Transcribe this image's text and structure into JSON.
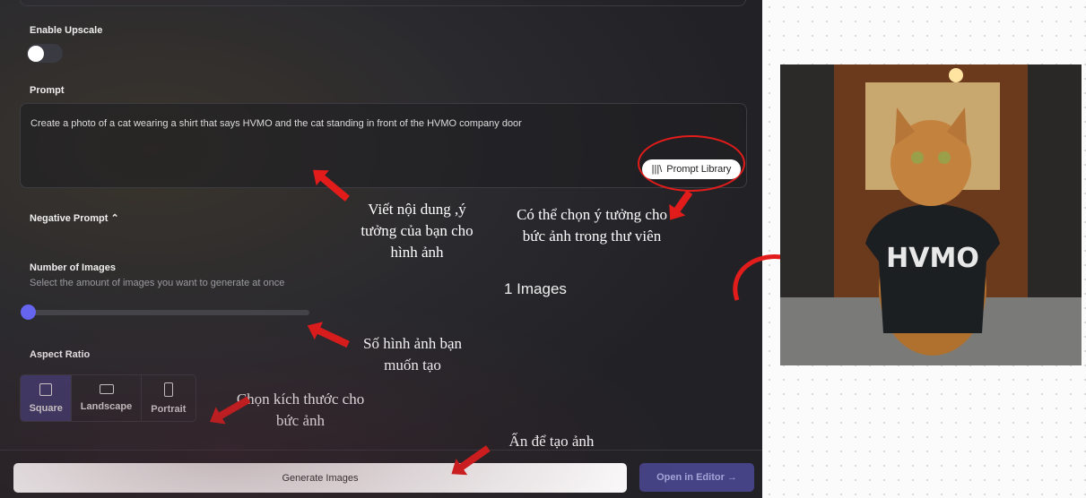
{
  "form": {
    "upscale_label": "Enable Upscale",
    "upscale_enabled": false,
    "prompt_label": "Prompt",
    "prompt_value": "Create a photo of a cat wearing a shirt that says HVMO and the cat standing in front of the HVMO company door",
    "prompt_library": "Prompt Library",
    "negative_prompt_label": "Negative Prompt",
    "num_images_label": "Number of Images",
    "num_images_hint": "Select the amount of images you want to generate at once",
    "num_images_value": 1,
    "num_images_text": "1 Images",
    "aspect_label": "Aspect Ratio",
    "aspect_options": [
      {
        "label": "Square",
        "selected": true
      },
      {
        "label": "Landscape",
        "selected": false
      },
      {
        "label": "Portrait",
        "selected": false
      }
    ]
  },
  "footer": {
    "generate": "Generate Images",
    "open_editor": "Open in Editor"
  },
  "annotations": {
    "prompt_note": "Viết nội dung ,ý tưởng của bạn cho hình ảnh",
    "library_note": "Có thể chọn ý tưởng cho bức ảnh trong thư viên",
    "count_note": "Số hình ảnh bạn muốn tạo",
    "aspect_note": "Chọn kích thước cho bức ảnh",
    "generate_note": "Ấn để tạo ảnh"
  },
  "preview": {
    "shirt_text": "HVMO"
  },
  "colors": {
    "accent": "#6565f0",
    "annotation": "#e21b1b",
    "selected": "#3d3a6a"
  }
}
